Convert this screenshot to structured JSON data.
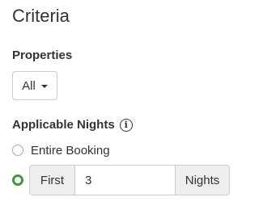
{
  "header": {
    "title": "Criteria"
  },
  "properties": {
    "label": "Properties",
    "selected": "All",
    "icon": "caret-down-icon"
  },
  "applicable_nights": {
    "label": "Applicable Nights",
    "info_icon": "info-icon",
    "info_glyph": "i",
    "options": [
      {
        "label": "Entire Booking",
        "checked": false
      },
      {
        "label": "First",
        "checked": true
      }
    ],
    "first_count": "3",
    "nights_suffix": "Nights"
  },
  "colors": {
    "radio_checked": "#3c9a3c",
    "addon_background": "#eeeeee",
    "border": "#cccccc",
    "text": "#333333"
  }
}
